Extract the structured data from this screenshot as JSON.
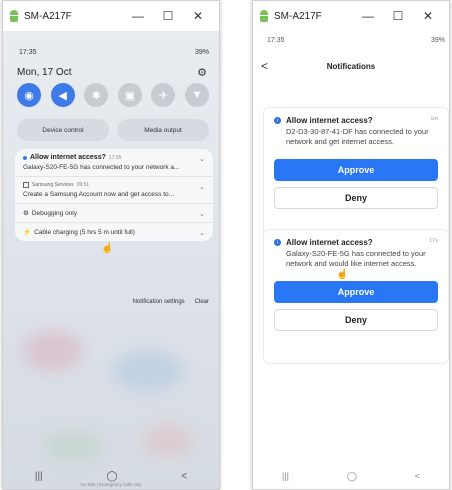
{
  "windows": [
    {
      "title": "SM-A217F",
      "controls": {
        "minimize": "—",
        "maximize": "☐",
        "close": "✕"
      },
      "status": {
        "time": "17:35",
        "battery": "39%"
      },
      "date": "Mon, 17 Oct",
      "quick_settings": [
        {
          "icon": "wifi-icon",
          "glyph": "◉",
          "on": true
        },
        {
          "icon": "sound-icon",
          "glyph": "◀",
          "on": true
        },
        {
          "icon": "bluetooth-icon",
          "glyph": "✱",
          "on": false
        },
        {
          "icon": "rotate-icon",
          "glyph": "▣",
          "on": false
        },
        {
          "icon": "airplane-icon",
          "glyph": "✈",
          "on": false
        },
        {
          "icon": "flashlight-icon",
          "glyph": "▼",
          "on": false
        }
      ],
      "pills": {
        "device_control": "Device control",
        "media_output": "Media output"
      },
      "notifications": [
        {
          "title": "Allow internet access?",
          "time": "17:35",
          "text": "Galaxy-S20-FE-5G has connected to your network a..."
        },
        {
          "app": "Samsung Services",
          "time": "09:51",
          "text": "Create a Samsung Account now and get access to..."
        },
        {
          "text": "Debugging only"
        },
        {
          "text": "Cable charging (5 hrs 5 m until full)"
        }
      ],
      "notif_actions": {
        "settings": "Notification settings",
        "clear": "Clear"
      },
      "lock_text": "No SIM | Emergency calls only",
      "nav": {
        "recents": "|||",
        "home": "◯",
        "back": "<"
      }
    },
    {
      "title": "SM-A217F",
      "controls": {
        "minimize": "—",
        "maximize": "☐",
        "close": "✕"
      },
      "status": {
        "time": "17:35",
        "battery": "39%"
      },
      "header": {
        "back": "<",
        "title": "Notifications"
      },
      "cards": [
        {
          "title": "Allow internet access?",
          "time": "1m",
          "body": "D2-D3-30-87-41-DF has connected to your network and get internet access.",
          "approve": "Approve",
          "deny": "Deny"
        },
        {
          "title": "Allow internet access?",
          "time": "17s",
          "body": "Galaxy-S20-FE-5G has connected to your network and would like internet access.",
          "approve": "Approve",
          "deny": "Deny"
        }
      ],
      "nav": {
        "recents": "|||",
        "home": "◯",
        "back": "<"
      }
    }
  ],
  "colors": {
    "accent": "#2977f4",
    "qs_on": "#3e7be6",
    "android_green": "#78c257"
  }
}
